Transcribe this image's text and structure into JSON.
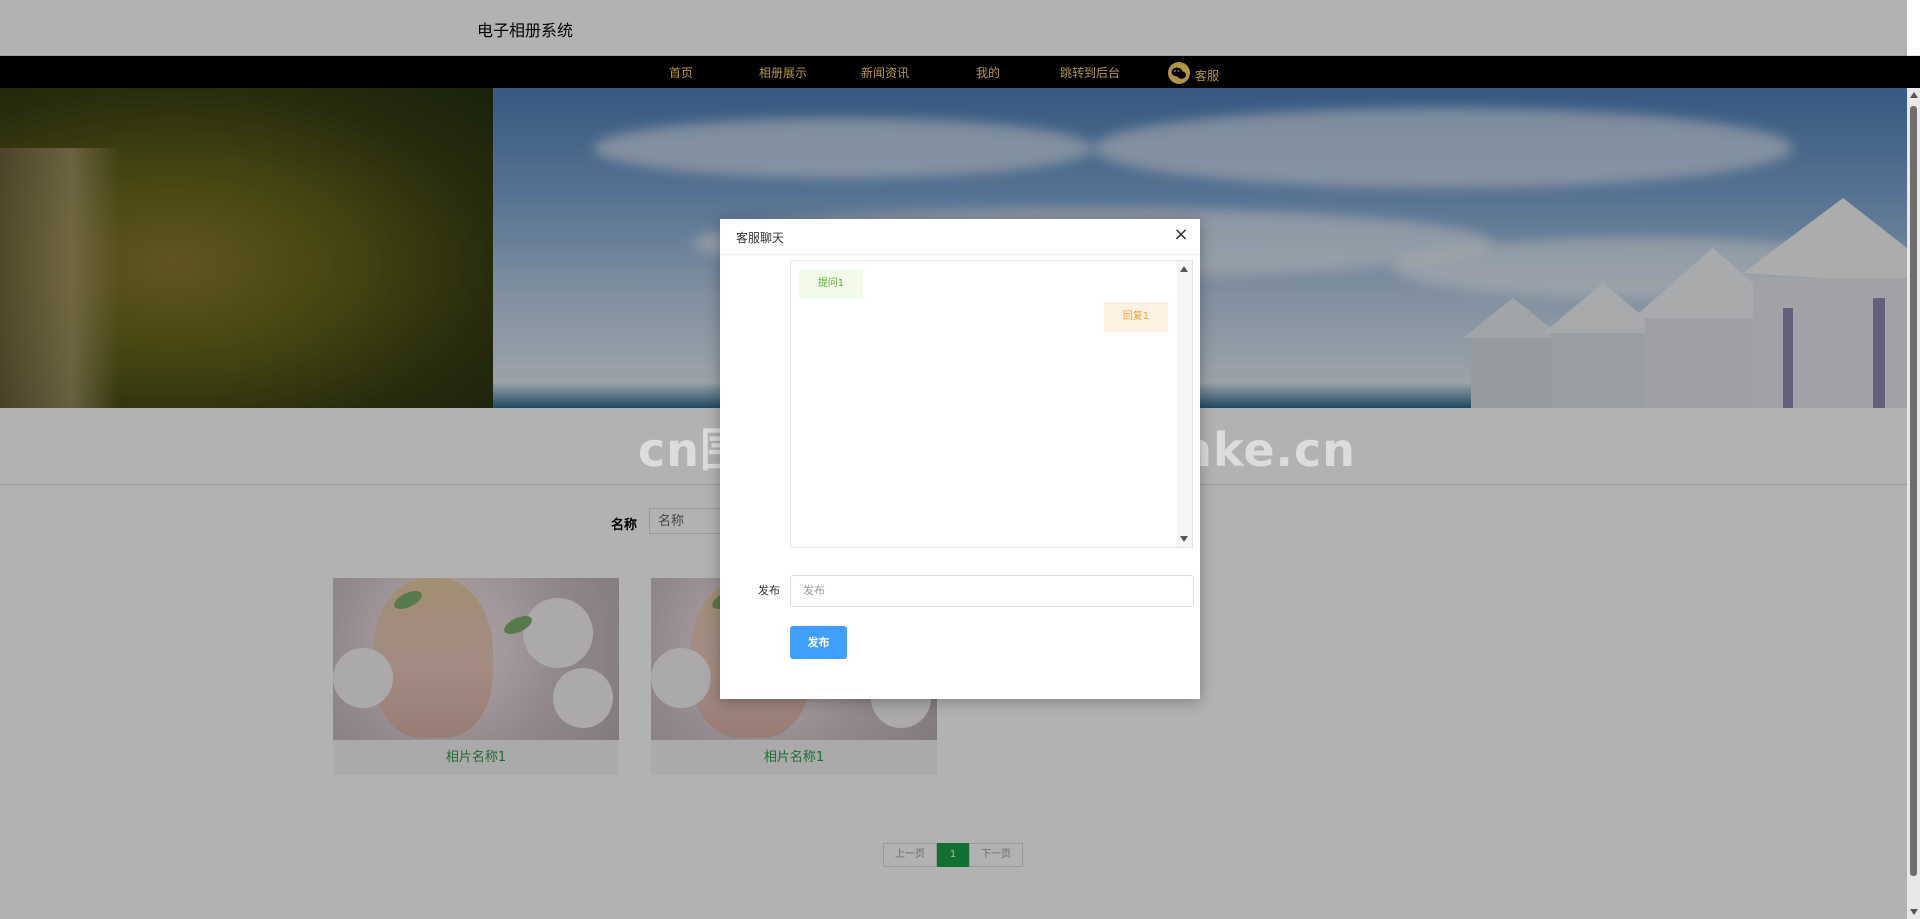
{
  "site": {
    "title": "电子相册系统"
  },
  "nav": {
    "items": [
      {
        "label": "首页"
      },
      {
        "label": "相册展示"
      },
      {
        "label": "新闻资讯"
      },
      {
        "label": "我的"
      },
      {
        "label": "跳转到后台"
      },
      {
        "label": "客服"
      }
    ]
  },
  "search": {
    "label": "名称",
    "placeholder": "名称"
  },
  "albums": [
    {
      "name": "相片名称1"
    },
    {
      "name": "相片名称1"
    }
  ],
  "pagination": {
    "prev": "上一页",
    "current": "1",
    "next": "下一页"
  },
  "watermark": "cn围观客www.weiguanke.cn",
  "modal": {
    "title": "客服聊天",
    "messages": [
      {
        "role": "question",
        "text": "提问1"
      },
      {
        "role": "reply",
        "text": "回复1"
      }
    ],
    "publish_label": "发布",
    "publish_placeholder": "发布",
    "publish_button": "发布"
  },
  "colors": {
    "nav_text": "#ffd564",
    "accent_green": "#1e9f48",
    "primary_button": "#409eff"
  }
}
